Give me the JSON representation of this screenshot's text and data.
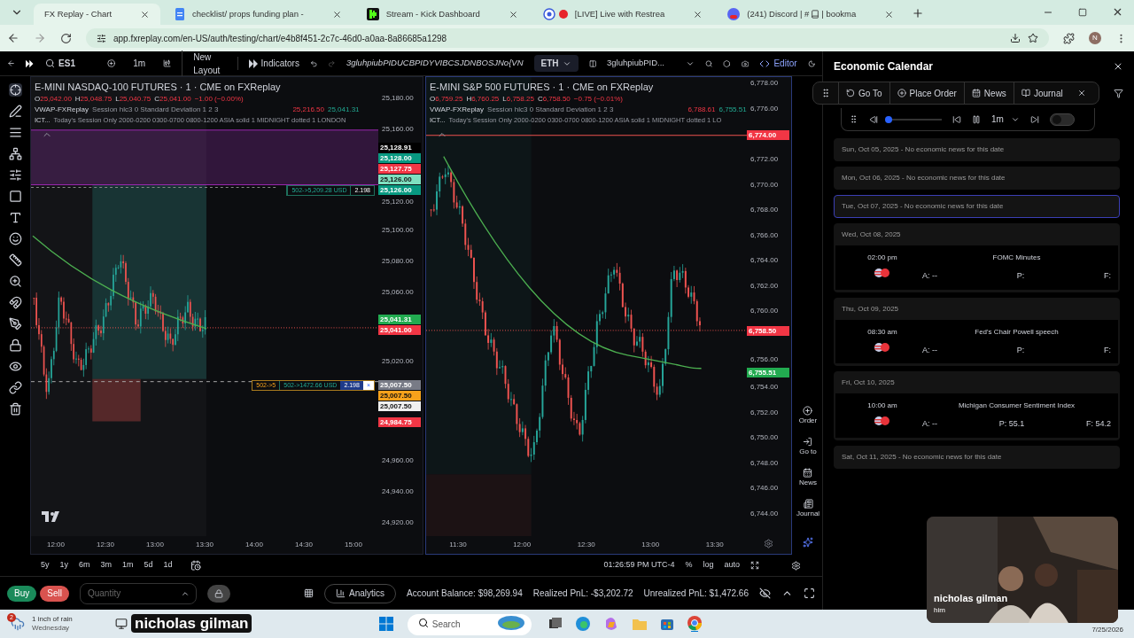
{
  "browser": {
    "tabs": [
      {
        "title": "FX Replay - Chart",
        "selected": true
      },
      {
        "title": "checklist/ props funding plan -",
        "selected": false
      },
      {
        "title": "Stream - Kick Dashboard",
        "selected": false
      },
      {
        "title": "[LIVE] Live with Restrea",
        "selected": false
      },
      {
        "title": "(241) Discord | #",
        "title_after": "| bookma",
        "selected": false
      }
    ],
    "url": "app.fxreplay.com/en-US/auth/testing/chart/e4b8f451-2c7c-46d0-a0aa-8a86685a1298",
    "profile": "N"
  },
  "toolbar": {
    "symbol": "ES1",
    "interval": "1m",
    "layout": "New Layout",
    "indicators": "Indicators",
    "strategy": "3gluhpiubPIDUCBPIDYVIBCSJDNBOSJNo{VN",
    "session": "ETH",
    "strategy_short": "3gluhpiubPID...",
    "editor": "Editor"
  },
  "charts": [
    {
      "title": "E-MINI NASDAQ-100 FUTURES · 1 · CME on FXReplay",
      "ohlc": [
        {
          "key": "O",
          "value": "25,042.00"
        },
        {
          "key": "H",
          "value": "25,048.75"
        },
        {
          "key": "L",
          "value": "25,040.75"
        },
        {
          "key": "C",
          "value": "25,041.00"
        }
      ],
      "change": "−1.00 (−0.00%)",
      "vwap": {
        "name": "VWAP-FXReplay",
        "params": "Session hlc3 0 Standard Deviation 1 2 3",
        "values": [
          "25,216.50",
          "25,041.31"
        ]
      },
      "ict": {
        "name": "ICT...",
        "params": "Today's Session Only 2000-0200 0300-0700 0800-1200 ASIA solid 1 MIDNIGHT dotted 1 LONDON"
      },
      "price_axis": [
        "25,180.00",
        "25,160.00",
        "25,120.00",
        "25,100.00",
        "25,080.00",
        "25,060.00",
        "25,020.00",
        "24,960.00",
        "24,940.00",
        "24,920.00"
      ],
      "price_tags": [
        {
          "label": "25,128.91",
          "color": "#000000"
        },
        {
          "label": "25,128.00",
          "color": "#089981"
        },
        {
          "label": "25,127.75",
          "color": "#f23645"
        },
        {
          "label": "25,126.00",
          "color": "#7fe0c0"
        },
        {
          "label": "25,126.00",
          "color": "#089981"
        },
        {
          "label": "25,041.31",
          "color": "#22ab50"
        },
        {
          "label": "25,041.00",
          "color": "#f23645"
        },
        {
          "label": "25,007.50",
          "color": "#787b86"
        },
        {
          "label": "25,007.50",
          "color": "#f7a21b"
        },
        {
          "label": "25,007.50",
          "color": "#f0f0f0"
        },
        {
          "label": "24,984.75",
          "color": "#f23645"
        }
      ],
      "orders": [
        {
          "pnl": "502->5,209.28 USD",
          "qty": "2.198"
        },
        {
          "prefix": "502->5",
          "pnl": "502->1472.66 USD",
          "qty": "2.198",
          "close": "×"
        }
      ],
      "time_axis": [
        "12:00",
        "12:30",
        "13:00",
        "13:30",
        "14:00",
        "14:30",
        "15:00"
      ]
    },
    {
      "title": "E-MINI S&P 500 FUTURES · 1 · CME on FXReplay",
      "ohlc": [
        {
          "key": "O",
          "value": "6,759.25"
        },
        {
          "key": "H",
          "value": "6,760.25"
        },
        {
          "key": "L",
          "value": "6,758.25"
        },
        {
          "key": "C",
          "value": "6,758.50"
        }
      ],
      "change": "−0.75 (−0.01%)",
      "vwap": {
        "name": "VWAP-FXReplay",
        "params": "Session hlc3 0 Standard Deviation 1 2 3",
        "values": [
          "6,788.61",
          "6,755.51"
        ]
      },
      "ict": {
        "name": "ICT...",
        "params": "Today's Session Only 2000-0200 0300-0700 0800-1200 ASIA solid 1 MIDNIGHT dotted 1 LO"
      },
      "price_axis": [
        "6,778.00",
        "6,776.00",
        "6,772.00",
        "6,770.00",
        "6,768.00",
        "6,766.00",
        "6,764.00",
        "6,762.00",
        "6,760.00",
        "6,756.00",
        "6,754.00",
        "6,752.00",
        "6,750.00",
        "6,748.00",
        "6,746.00",
        "6,744.00"
      ],
      "price_tags": [
        {
          "label": "6,774.00",
          "color": "#f23645"
        },
        {
          "label": "6,758.50",
          "color": "#f23645"
        },
        {
          "label": "6,755.51",
          "color": "#22ab50"
        }
      ],
      "time_axis": [
        "11:30",
        "12:00",
        "12:30",
        "13:00",
        "13:30"
      ]
    }
  ],
  "range_bar": {
    "ranges": [
      "5y",
      "1y",
      "6m",
      "3m",
      "1m",
      "5d",
      "1d"
    ],
    "clock": "01:26:59 PM UTC-4",
    "options": [
      "%",
      "log",
      "auto"
    ]
  },
  "side_tools": [
    "Order",
    "Go to",
    "News",
    "Journal"
  ],
  "trading_bar": {
    "buy": "Buy",
    "sell": "Sell",
    "quantity_placeholder": "Quantity",
    "analytics": "Analytics",
    "balance": "Account Balance: $98,269.94",
    "realized": "Realized PnL: -$3,202.72",
    "unrealized": "Unrealized PnL: $1,472.66"
  },
  "calendar": {
    "title": "Economic Calendar",
    "actions": [
      "Go To",
      "Place Order",
      "News",
      "Journal"
    ],
    "player": {
      "interval": "1m",
      "level": 0.0,
      "on": false
    },
    "days": [
      {
        "label": "Sun, Oct 05, 2025 - No economic news for this date",
        "selected": false
      },
      {
        "label": "Mon, Oct 06, 2025 - No economic news for this date",
        "selected": false
      },
      {
        "label": "Tue, Oct 07, 2025 - No economic news for this date",
        "selected": true
      },
      {
        "label": "Wed, Oct 08, 2025",
        "selected": false,
        "events": [
          {
            "time": "02:00 pm",
            "title": "FOMC Minutes",
            "actual": "A: --",
            "previous": "P:",
            "forecast": "F:"
          }
        ]
      },
      {
        "label": "Thu, Oct 09, 2025",
        "selected": false,
        "events": [
          {
            "time": "08:30 am",
            "title": "Fed's Chair Powell speech",
            "actual": "A: --",
            "previous": "P:",
            "forecast": "F:"
          }
        ]
      },
      {
        "label": "Fri, Oct 10, 2025",
        "selected": false,
        "events": [
          {
            "time": "10:00 am",
            "title": "Michigan Consumer Sentiment Index",
            "actual": "A: --",
            "previous": "P: 55.1",
            "forecast": "F: 54.2"
          }
        ]
      },
      {
        "label": "Sat, Oct 11, 2025 - No economic news for this date",
        "selected": false
      }
    ]
  },
  "stream": {
    "caption": "nicholas gilman",
    "webcam": {
      "kind": "picture",
      "name": "nicholas gilman",
      "pronoun": "him"
    }
  },
  "taskbar": {
    "weather": "1 inch of rain",
    "day": "Wednesday",
    "badge": "2",
    "search_placeholder": "Search",
    "date": "7/25/2026"
  }
}
